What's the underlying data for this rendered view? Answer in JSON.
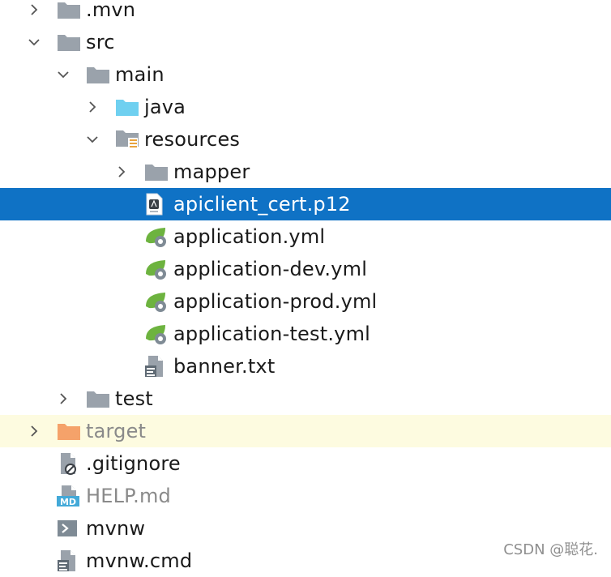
{
  "tree": {
    "rows": [
      {
        "label": ".mvn"
      },
      {
        "label": "src"
      },
      {
        "label": "main"
      },
      {
        "label": "java"
      },
      {
        "label": "resources"
      },
      {
        "label": "mapper"
      },
      {
        "label": "apiclient_cert.p12"
      },
      {
        "label": "application.yml"
      },
      {
        "label": "application-dev.yml"
      },
      {
        "label": "application-prod.yml"
      },
      {
        "label": "application-test.yml"
      },
      {
        "label": "banner.txt"
      },
      {
        "label": "test"
      },
      {
        "label": "target"
      },
      {
        "label": ".gitignore"
      },
      {
        "label": "HELP.md"
      },
      {
        "label": "mvnw"
      },
      {
        "label": "mvnw.cmd"
      }
    ]
  },
  "icons": {
    "md_badge": "MD"
  },
  "watermark": "CSDN @聪花.",
  "colors": {
    "selection": "#0f72c5",
    "highlight_row": "#fdfbe0",
    "folder_gray": "#9aa2ab",
    "java_folder": "#6fd0f0",
    "target_folder": "#f5a26a",
    "spring_green": "#6db33f"
  }
}
